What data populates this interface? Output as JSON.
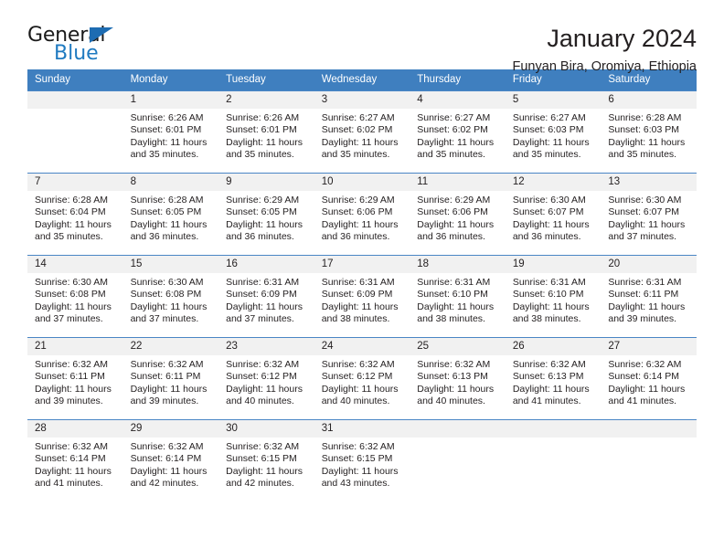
{
  "brand": {
    "name_part1": "General",
    "name_part2": "Blue",
    "triangle_color": "#1d6cb2",
    "blue_color": "#1f7ac0"
  },
  "header": {
    "title": "January 2024",
    "subtitle": "Funyan Bira, Oromiya, Ethiopia"
  },
  "calendar": {
    "header_bg": "#3f7fbf",
    "daynum_bg": "#f1f1f1",
    "weekdays": [
      "Sunday",
      "Monday",
      "Tuesday",
      "Wednesday",
      "Thursday",
      "Friday",
      "Saturday"
    ],
    "weeks": [
      [
        {
          "day": "",
          "sunrise": "",
          "sunset": "",
          "daylight": ""
        },
        {
          "day": "1",
          "sunrise": "Sunrise: 6:26 AM",
          "sunset": "Sunset: 6:01 PM",
          "daylight": "Daylight: 11 hours and 35 minutes."
        },
        {
          "day": "2",
          "sunrise": "Sunrise: 6:26 AM",
          "sunset": "Sunset: 6:01 PM",
          "daylight": "Daylight: 11 hours and 35 minutes."
        },
        {
          "day": "3",
          "sunrise": "Sunrise: 6:27 AM",
          "sunset": "Sunset: 6:02 PM",
          "daylight": "Daylight: 11 hours and 35 minutes."
        },
        {
          "day": "4",
          "sunrise": "Sunrise: 6:27 AM",
          "sunset": "Sunset: 6:02 PM",
          "daylight": "Daylight: 11 hours and 35 minutes."
        },
        {
          "day": "5",
          "sunrise": "Sunrise: 6:27 AM",
          "sunset": "Sunset: 6:03 PM",
          "daylight": "Daylight: 11 hours and 35 minutes."
        },
        {
          "day": "6",
          "sunrise": "Sunrise: 6:28 AM",
          "sunset": "Sunset: 6:03 PM",
          "daylight": "Daylight: 11 hours and 35 minutes."
        }
      ],
      [
        {
          "day": "7",
          "sunrise": "Sunrise: 6:28 AM",
          "sunset": "Sunset: 6:04 PM",
          "daylight": "Daylight: 11 hours and 35 minutes."
        },
        {
          "day": "8",
          "sunrise": "Sunrise: 6:28 AM",
          "sunset": "Sunset: 6:05 PM",
          "daylight": "Daylight: 11 hours and 36 minutes."
        },
        {
          "day": "9",
          "sunrise": "Sunrise: 6:29 AM",
          "sunset": "Sunset: 6:05 PM",
          "daylight": "Daylight: 11 hours and 36 minutes."
        },
        {
          "day": "10",
          "sunrise": "Sunrise: 6:29 AM",
          "sunset": "Sunset: 6:06 PM",
          "daylight": "Daylight: 11 hours and 36 minutes."
        },
        {
          "day": "11",
          "sunrise": "Sunrise: 6:29 AM",
          "sunset": "Sunset: 6:06 PM",
          "daylight": "Daylight: 11 hours and 36 minutes."
        },
        {
          "day": "12",
          "sunrise": "Sunrise: 6:30 AM",
          "sunset": "Sunset: 6:07 PM",
          "daylight": "Daylight: 11 hours and 36 minutes."
        },
        {
          "day": "13",
          "sunrise": "Sunrise: 6:30 AM",
          "sunset": "Sunset: 6:07 PM",
          "daylight": "Daylight: 11 hours and 37 minutes."
        }
      ],
      [
        {
          "day": "14",
          "sunrise": "Sunrise: 6:30 AM",
          "sunset": "Sunset: 6:08 PM",
          "daylight": "Daylight: 11 hours and 37 minutes."
        },
        {
          "day": "15",
          "sunrise": "Sunrise: 6:30 AM",
          "sunset": "Sunset: 6:08 PM",
          "daylight": "Daylight: 11 hours and 37 minutes."
        },
        {
          "day": "16",
          "sunrise": "Sunrise: 6:31 AM",
          "sunset": "Sunset: 6:09 PM",
          "daylight": "Daylight: 11 hours and 37 minutes."
        },
        {
          "day": "17",
          "sunrise": "Sunrise: 6:31 AM",
          "sunset": "Sunset: 6:09 PM",
          "daylight": "Daylight: 11 hours and 38 minutes."
        },
        {
          "day": "18",
          "sunrise": "Sunrise: 6:31 AM",
          "sunset": "Sunset: 6:10 PM",
          "daylight": "Daylight: 11 hours and 38 minutes."
        },
        {
          "day": "19",
          "sunrise": "Sunrise: 6:31 AM",
          "sunset": "Sunset: 6:10 PM",
          "daylight": "Daylight: 11 hours and 38 minutes."
        },
        {
          "day": "20",
          "sunrise": "Sunrise: 6:31 AM",
          "sunset": "Sunset: 6:11 PM",
          "daylight": "Daylight: 11 hours and 39 minutes."
        }
      ],
      [
        {
          "day": "21",
          "sunrise": "Sunrise: 6:32 AM",
          "sunset": "Sunset: 6:11 PM",
          "daylight": "Daylight: 11 hours and 39 minutes."
        },
        {
          "day": "22",
          "sunrise": "Sunrise: 6:32 AM",
          "sunset": "Sunset: 6:11 PM",
          "daylight": "Daylight: 11 hours and 39 minutes."
        },
        {
          "day": "23",
          "sunrise": "Sunrise: 6:32 AM",
          "sunset": "Sunset: 6:12 PM",
          "daylight": "Daylight: 11 hours and 40 minutes."
        },
        {
          "day": "24",
          "sunrise": "Sunrise: 6:32 AM",
          "sunset": "Sunset: 6:12 PM",
          "daylight": "Daylight: 11 hours and 40 minutes."
        },
        {
          "day": "25",
          "sunrise": "Sunrise: 6:32 AM",
          "sunset": "Sunset: 6:13 PM",
          "daylight": "Daylight: 11 hours and 40 minutes."
        },
        {
          "day": "26",
          "sunrise": "Sunrise: 6:32 AM",
          "sunset": "Sunset: 6:13 PM",
          "daylight": "Daylight: 11 hours and 41 minutes."
        },
        {
          "day": "27",
          "sunrise": "Sunrise: 6:32 AM",
          "sunset": "Sunset: 6:14 PM",
          "daylight": "Daylight: 11 hours and 41 minutes."
        }
      ],
      [
        {
          "day": "28",
          "sunrise": "Sunrise: 6:32 AM",
          "sunset": "Sunset: 6:14 PM",
          "daylight": "Daylight: 11 hours and 41 minutes."
        },
        {
          "day": "29",
          "sunrise": "Sunrise: 6:32 AM",
          "sunset": "Sunset: 6:14 PM",
          "daylight": "Daylight: 11 hours and 42 minutes."
        },
        {
          "day": "30",
          "sunrise": "Sunrise: 6:32 AM",
          "sunset": "Sunset: 6:15 PM",
          "daylight": "Daylight: 11 hours and 42 minutes."
        },
        {
          "day": "31",
          "sunrise": "Sunrise: 6:32 AM",
          "sunset": "Sunset: 6:15 PM",
          "daylight": "Daylight: 11 hours and 43 minutes."
        },
        {
          "day": "",
          "sunrise": "",
          "sunset": "",
          "daylight": ""
        },
        {
          "day": "",
          "sunrise": "",
          "sunset": "",
          "daylight": ""
        },
        {
          "day": "",
          "sunrise": "",
          "sunset": "",
          "daylight": ""
        }
      ]
    ]
  }
}
